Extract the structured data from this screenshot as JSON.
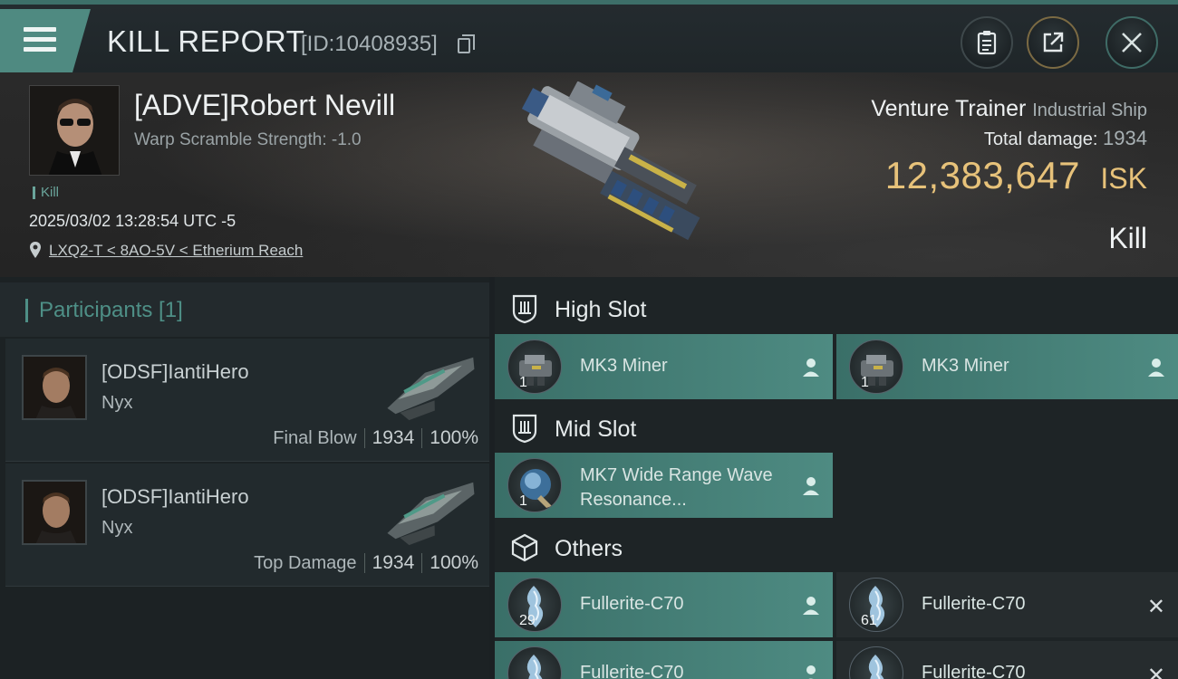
{
  "header": {
    "title": "KILL REPORT",
    "report_id": "[ID:10408935]"
  },
  "victim": {
    "name": "[ADVE]Robert Nevill",
    "warp_scramble": "Warp Scramble Strength: -1.0",
    "tag": "Kill",
    "datetime": "2025/03/02 13:28:54 UTC -5",
    "location": "LXQ2-T < 8AO-5V < Etherium Reach",
    "ship": "Venture Trainer",
    "ship_class": "Industrial Ship",
    "total_damage_label": "Total damage:",
    "total_damage": "1934",
    "isk_value": "12,383,647",
    "isk_unit": "ISK",
    "result": "Kill"
  },
  "participants": {
    "title": "Participants [1]",
    "cards": [
      {
        "name": "[ODSF]IantiHero",
        "ship": "Nyx",
        "label": "Final Blow",
        "damage": "1934",
        "percent": "100%"
      },
      {
        "name": "[ODSF]IantiHero",
        "ship": "Nyx",
        "label": "Top Damage",
        "damage": "1934",
        "percent": "100%"
      }
    ]
  },
  "slots": {
    "high": {
      "title": "High Slot",
      "items": [
        {
          "name": "MK3 Miner",
          "qty": "1"
        },
        {
          "name": "MK3 Miner",
          "qty": "1"
        }
      ]
    },
    "mid": {
      "title": "Mid Slot",
      "items": [
        {
          "name": "MK7 Wide Range Wave Resonance...",
          "qty": "1"
        }
      ]
    },
    "others": {
      "title": "Others",
      "items": [
        {
          "name": "Fullerite-C70",
          "qty": "29"
        },
        {
          "name": "Fullerite-C70",
          "qty": "61"
        },
        {
          "name": "Fullerite-C70",
          "qty": ""
        },
        {
          "name": "Fullerite-C70",
          "qty": ""
        }
      ]
    }
  },
  "colors": {
    "accent_teal": "#4e8b82",
    "isk_gold": "#e7c27a"
  }
}
